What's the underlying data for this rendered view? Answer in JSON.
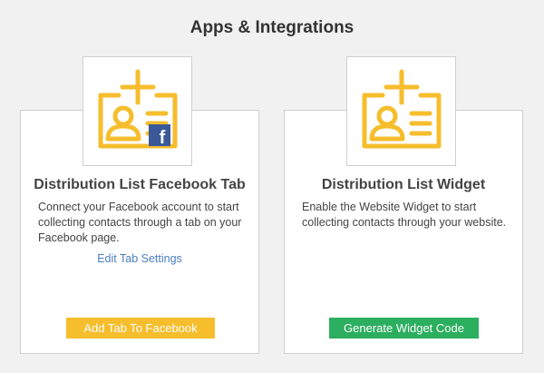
{
  "page": {
    "title": "Apps & Integrations"
  },
  "colors": {
    "accent_yellow": "#f6bd2c",
    "accent_green": "#2cae5f",
    "link_blue": "#4a7fc1",
    "facebook_blue": "#3b5998"
  },
  "cards": [
    {
      "title": "Distribution List Facebook Tab",
      "description": "Connect your Facebook account to start collecting contacts through a tab on your Facebook page.",
      "link": "Edit Tab Settings",
      "button": "Add Tab To Facebook",
      "icon": "contact-card-add-icon",
      "badge_icon": "facebook-icon",
      "badge_text": "f"
    },
    {
      "title": "Distribution List Widget",
      "description": "Enable the Website Widget to start collecting contacts through your website.",
      "button": "Generate Widget Code",
      "icon": "contact-card-add-icon"
    }
  ]
}
